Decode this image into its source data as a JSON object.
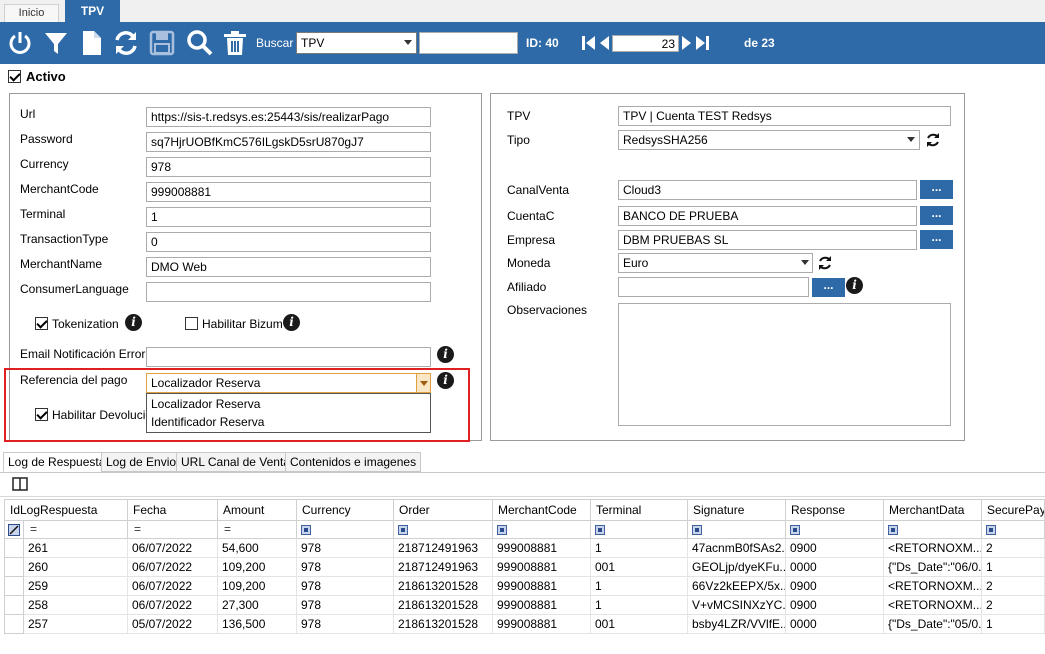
{
  "tabs": {
    "inicio": "Inicio",
    "tpv": "TPV"
  },
  "toolbar": {
    "buscar_label": "Buscar",
    "buscar_select": "TPV",
    "search_value": "",
    "id_label": "ID: 40",
    "record_current": "23",
    "record_total": "de 23",
    "icons": [
      "power-icon",
      "filter-icon",
      "new-document-icon",
      "refresh-icon",
      "save-icon",
      "search-icon",
      "delete-icon"
    ]
  },
  "activo": {
    "label": "Activo",
    "checked": true
  },
  "left_panel": {
    "fields": [
      {
        "label": "Url",
        "value": "https://sis-t.redsys.es:25443/sis/realizarPago"
      },
      {
        "label": "Password",
        "value": "sq7HjrUOBfKmC576ILgskD5srU870gJ7"
      },
      {
        "label": "Currency",
        "value": "978"
      },
      {
        "label": "MerchantCode",
        "value": "999008881"
      },
      {
        "label": "Terminal",
        "value": "1"
      },
      {
        "label": "TransactionType",
        "value": "0"
      },
      {
        "label": "MerchantName",
        "value": "DMO Web"
      },
      {
        "label": "ConsumerLanguage",
        "value": ""
      }
    ],
    "tokenization_label": "Tokenization",
    "tokenization_checked": true,
    "bizum_label": "Habilitar Bizum",
    "bizum_checked": false,
    "email_label": "Email Notificación Error",
    "email_value": "",
    "referencia_label": "Referencia del pago",
    "referencia_value": "Localizador Reserva",
    "referencia_options": [
      "Localizador Reserva",
      "Identificador Reserva"
    ],
    "devolucion_label": "Habilitar Devolución",
    "devolucion_checked": true
  },
  "right_panel": {
    "tpv_label": "TPV",
    "tpv_value": "TPV | Cuenta TEST Redsys",
    "tipo_label": "Tipo",
    "tipo_value": "RedsysSHA256",
    "canal_label": "CanalVenta",
    "canal_value": "Cloud3",
    "cuenta_label": "CuentaC",
    "cuenta_value": "BANCO DE PRUEBA",
    "empresa_label": "Empresa",
    "empresa_value": "DBM PRUEBAS SL",
    "moneda_label": "Moneda",
    "moneda_value": "Euro",
    "afiliado_label": "Afiliado",
    "afiliado_value": "",
    "observaciones_label": "Observaciones",
    "observaciones_value": "",
    "dots": "..."
  },
  "bottom_tabs": [
    "Log de Respuesta",
    "Log de Envio",
    "URL Canal de Venta",
    "Contenidos e imagenes"
  ],
  "grid": {
    "columns": [
      "IdLogRespuesta",
      "Fecha",
      "Amount",
      "Currency",
      "Order",
      "MerchantCode",
      "Terminal",
      "Signature",
      "Response",
      "MerchantData",
      "SecurePayment"
    ],
    "rows": [
      [
        "261",
        "06/07/2022",
        "54,600",
        "978",
        "218712491963",
        "999008881",
        "1",
        "47acnmB0fSAs2...",
        "0900",
        "<RETORNOXM...",
        "2"
      ],
      [
        "260",
        "06/07/2022",
        "109,200",
        "978",
        "218712491963",
        "999008881",
        "001",
        "GEOLjp/dyeKFu...",
        "0000",
        "{\"Ds_Date\":\"06/0...",
        "1"
      ],
      [
        "259",
        "06/07/2022",
        "109,200",
        "978",
        "218613201528",
        "999008881",
        "1",
        "66Vz2kEEPX/5x...",
        "0900",
        "<RETORNOXM...",
        "2"
      ],
      [
        "258",
        "06/07/2022",
        "27,300",
        "978",
        "218613201528",
        "999008881",
        "1",
        "V+vMCSINXzYC...",
        "0900",
        "<RETORNOXM...",
        "2"
      ],
      [
        "257",
        "05/07/2022",
        "136,500",
        "978",
        "218613201528",
        "999008881",
        "001",
        "bsby4LZR/VVlfE...",
        "0000",
        "{\"Ds_Date\":\"05/0...",
        "1"
      ]
    ]
  },
  "colors": {
    "brand": "#2e6aa8",
    "highlight": "#e02020"
  }
}
